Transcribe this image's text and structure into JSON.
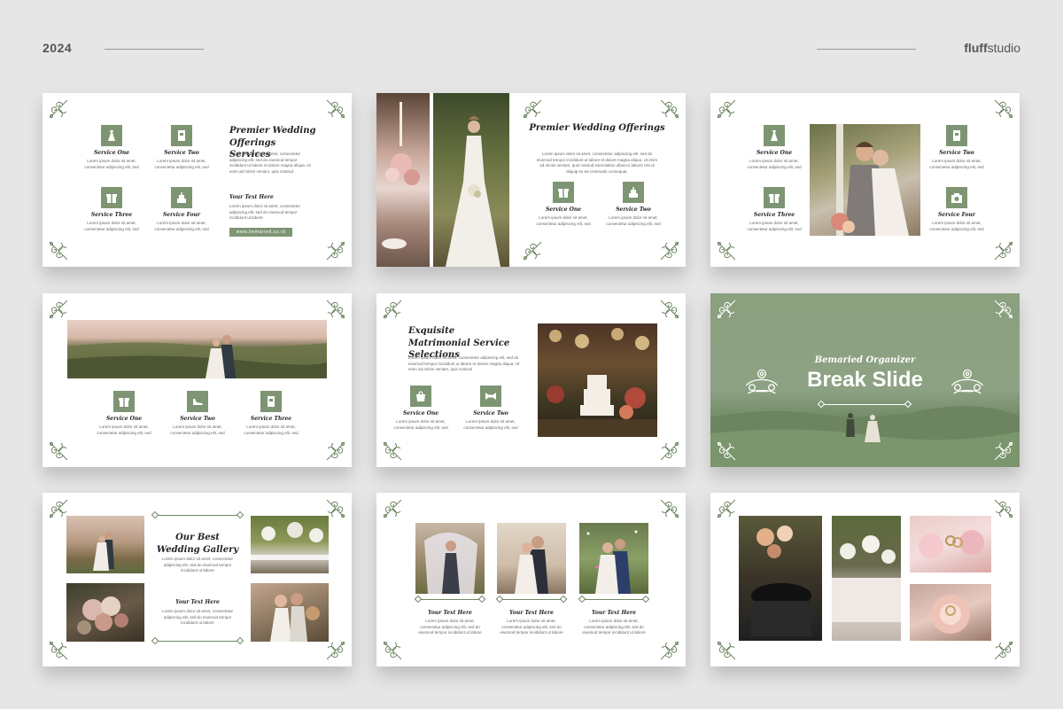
{
  "header": {
    "year": "2024",
    "brand_bold": "fluff",
    "brand_rest": "studio"
  },
  "common": {
    "lorem2": "Lorem ipsum dolor sit amet, consectetur adipiscing elit, sed",
    "lorem_long": "Lorem ipsum dolor sit amet, consectetur adipiscing elit, sed do eiusmod tempor incididunt ut labore et dolore magna aliqua. Ut enim ad minim veniam, quis nostrud exercitation ullamco laboris nisi ut aliquip ex ea commodo consequat.",
    "lorem_mid": "Lorem ipsum dolor sit amet, consectetur adipiscing elit, sed do eiusmod tempor incididunt ut labore et dolore magna aliqua. Ut enim ad minim veniam, quis nostrud",
    "lorem_short": "Lorem ipsum dolor sit amet, consectetur adipiscing elit, sed do eiusmod tempor incididunt ut labore"
  },
  "slide1": {
    "title": "Premier Wedding Offerings Services",
    "services": [
      "Service One",
      "Service Two",
      "Service Three",
      "Service Four"
    ],
    "your_text": "Your Text Here",
    "button": "www.bemaried.co.id"
  },
  "slide2": {
    "title": "Premier Wedding Offerings",
    "services": [
      "Service One",
      "Service Two"
    ]
  },
  "slide3": {
    "services": [
      "Service One",
      "Service Two",
      "Service Three",
      "Service Four"
    ]
  },
  "slide4": {
    "services": [
      "Service One",
      "Service Two",
      "Service Three"
    ]
  },
  "slide5": {
    "title": "Exquisite Matrimonial Service Selections",
    "services": [
      "Service One",
      "Service Two"
    ]
  },
  "slide6": {
    "subtitle": "Bemaried Organizer",
    "title": "Break Slide"
  },
  "slide7": {
    "title": "Our Best Wedding Gallery",
    "your_text": "Your Text Here"
  },
  "slide8": {
    "captions": [
      "Your Text Here",
      "Your Text Here",
      "Your Text Here"
    ]
  },
  "colors": {
    "accent": "#7e9573",
    "bg": "#e6e6e6"
  }
}
